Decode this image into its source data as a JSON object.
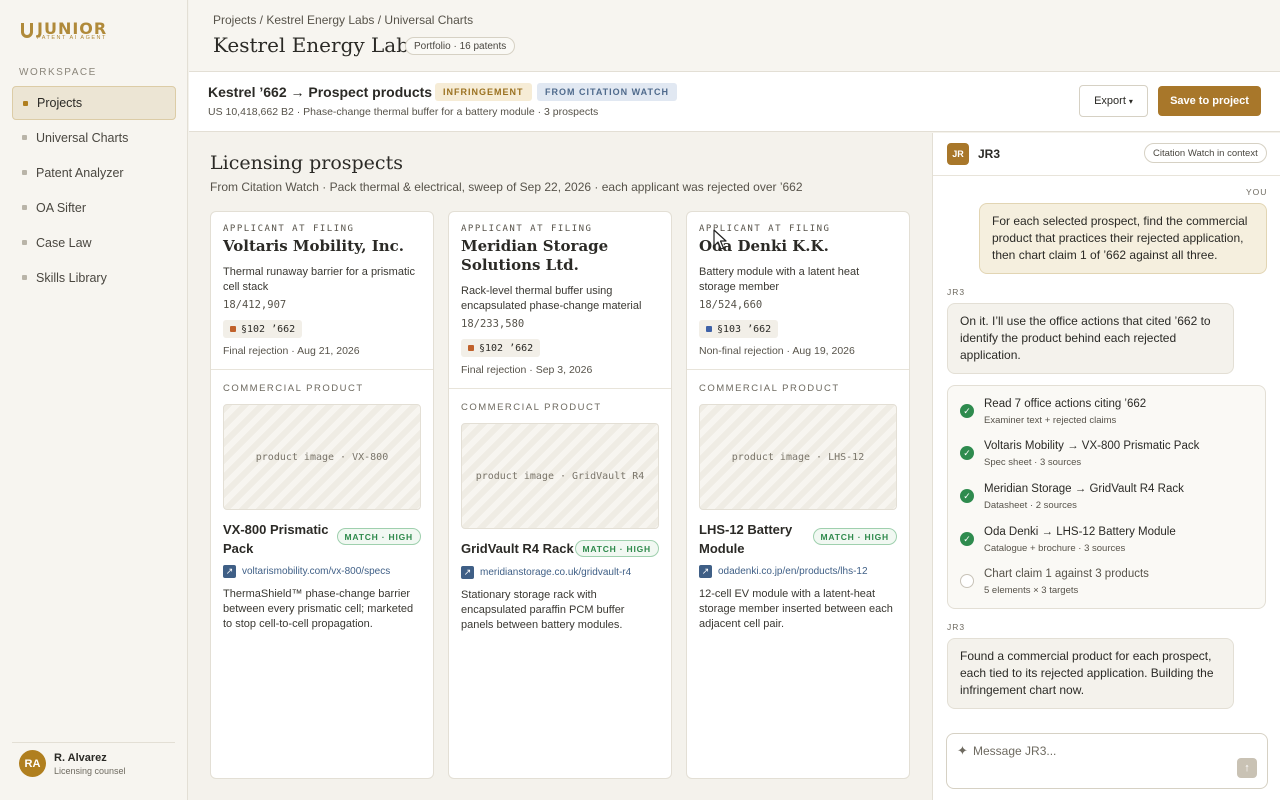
{
  "brand": {
    "name": "JUNIOR",
    "tagline": "PATENT AI AGENT",
    "accent": "#b08a3a"
  },
  "sidebar": {
    "section_label": "WORKSPACE",
    "items": [
      {
        "label": "Projects",
        "active": true
      },
      {
        "label": "Universal Charts",
        "active": false
      },
      {
        "label": "Patent Analyzer",
        "active": false
      },
      {
        "label": "OA Sifter",
        "active": false
      },
      {
        "label": "Case Law",
        "active": false
      },
      {
        "label": "Skills Library",
        "active": false
      }
    ],
    "user": {
      "initials": "RA",
      "name": "R. Alvarez",
      "role": "Licensing counsel"
    }
  },
  "header": {
    "breadcrumb": "Projects / Kestrel Energy Labs / Universal Charts",
    "title": "Kestrel Energy Labs",
    "badge": "Portfolio · 16 patents"
  },
  "subheader": {
    "title": "Kestrel ’662 → Prospect products",
    "tag_infringement": "INFRINGEMENT",
    "tag_citation": "FROM CITATION WATCH",
    "meta": "US 10,418,662 B2 · Phase-change thermal buffer for a battery module · 3 prospects",
    "export_label": "Export",
    "save_label": "Save to project"
  },
  "main": {
    "title": "Licensing prospects",
    "subtitle": "From Citation Watch · Pack thermal & electrical, sweep of Sep 22, 2026 · each applicant was rejected over ’662",
    "applicant_kicker": "APPLICANT AT FILING",
    "product_kicker": "COMMERCIAL PRODUCT",
    "cards": [
      {
        "applicant": "Voltaris Mobility, Inc.",
        "description": "Thermal runaway barrier for a prismatic cell stack",
        "app_no": "18/412,907",
        "citation": "§102 ’662",
        "citation_color": "#c0612b",
        "rejection": "Final rejection · Aug 21, 2026",
        "image_label": "product image · VX-800",
        "product": "VX-800 Prismatic Pack",
        "match": "MATCH · HIGH",
        "link": "voltarismobility.com/vx-800/specs",
        "product_desc": "ThermaShield™ phase-change barrier between every prismatic cell; marketed to stop cell-to-cell propagation."
      },
      {
        "applicant": "Meridian Storage Solutions Ltd.",
        "description": "Rack-level thermal buffer using encapsulated phase-change material",
        "app_no": "18/233,580",
        "citation": "§102 ’662",
        "citation_color": "#c0612b",
        "rejection": "Final rejection · Sep 3, 2026",
        "image_label": "product image · GridVault R4",
        "product": "GridVault R4 Rack",
        "match": "MATCH · HIGH",
        "link": "meridianstorage.co.uk/gridvault-r4",
        "product_desc": "Stationary storage rack with encapsulated paraffin PCM buffer panels between battery modules."
      },
      {
        "applicant": "Oda Denki K.K.",
        "description": "Battery module with a latent heat storage member",
        "app_no": "18/524,660",
        "citation": "§103 ’662",
        "citation_color": "#3f62a8",
        "rejection": "Non-final rejection · Aug 19, 2026",
        "image_label": "product image · LHS-12",
        "product": "LHS-12 Battery Module",
        "match": "MATCH · HIGH",
        "link": "odadenki.co.jp/en/products/lhs-12",
        "product_desc": "12-cell EV module with a latent-heat storage member inserted between each adjacent cell pair."
      }
    ]
  },
  "chat": {
    "agent_initials": "JR",
    "agent_name": "JR3",
    "context_chip": "Citation Watch in context",
    "you_label": "YOU",
    "agent_label": "JR3",
    "msg_user": "For each selected prospect, find the commercial product that practices their rejected application, then chart claim 1 of ’662 against all three.",
    "msg_agent_1": "On it. I’ll use the office actions that cited ’662 to identify the product behind each rejected application.",
    "tasks": [
      {
        "title": "Read 7 office actions citing ’662",
        "sub": "Examiner text + rejected claims",
        "done": true
      },
      {
        "title": "Voltaris Mobility → VX-800 Prismatic Pack",
        "sub": "Spec sheet · 3 sources",
        "done": true
      },
      {
        "title": "Meridian Storage → GridVault R4 Rack",
        "sub": "Datasheet · 2 sources",
        "done": true
      },
      {
        "title": "Oda Denki → LHS-12 Battery Module",
        "sub": "Catalogue + brochure · 3 sources",
        "done": true
      },
      {
        "title": "Chart claim 1 against 3 products",
        "sub": "5 elements × 3 targets",
        "done": false
      }
    ],
    "msg_agent_2": "Found a commercial product for each prospect, each tied to its rejected application. Building the infringement chart now.",
    "input_placeholder": "Message JR3..."
  }
}
